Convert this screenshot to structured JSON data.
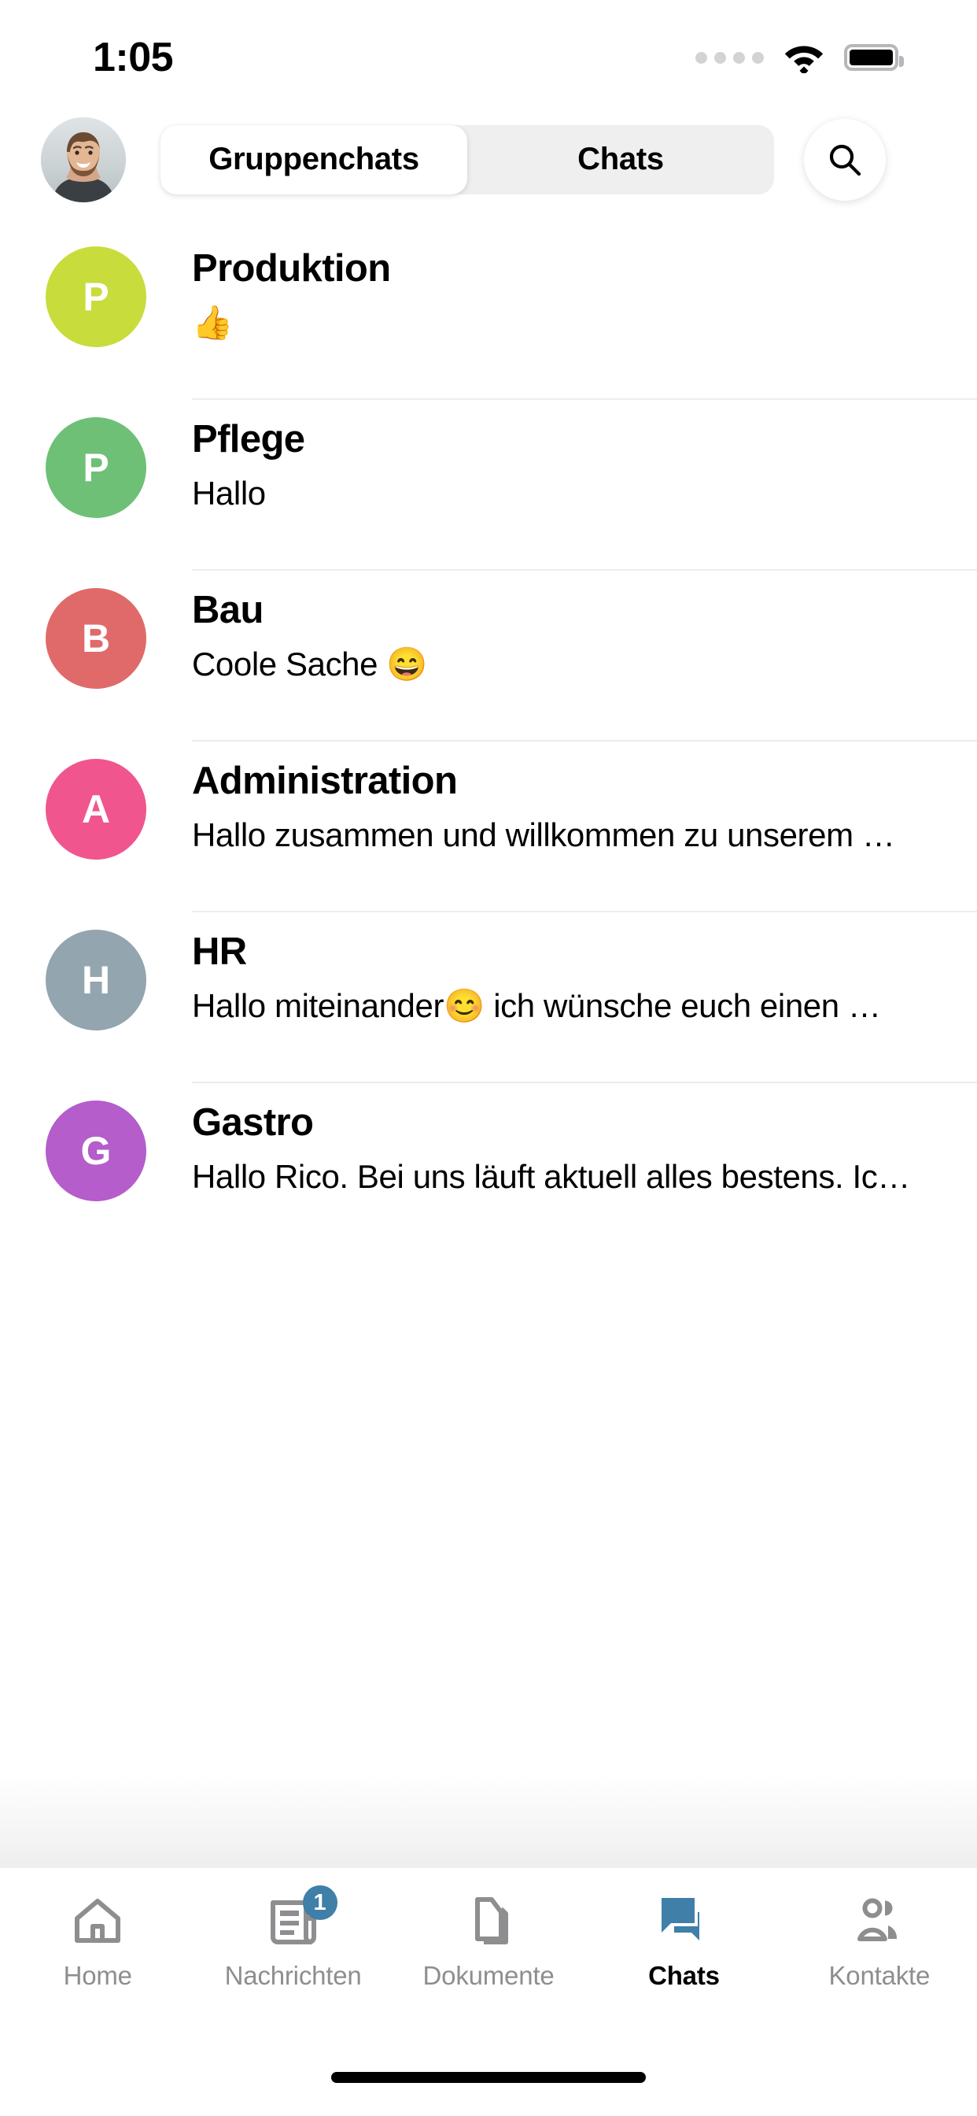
{
  "status_bar": {
    "time": "1:05",
    "dots_icon": "signal-dots-icon",
    "wifi_icon": "wifi-icon",
    "battery_icon": "battery-full-icon"
  },
  "header": {
    "avatar_name": "user-avatar-photo",
    "search_icon": "search-icon",
    "segments": [
      {
        "label": "Gruppenchats",
        "active": true
      },
      {
        "label": "Chats",
        "active": false
      }
    ]
  },
  "chats": [
    {
      "initial": "P",
      "title": "Produktion",
      "preview": "👍",
      "color": "#c8dc3c"
    },
    {
      "initial": "P",
      "title": "Pflege",
      "preview": "Hallo",
      "color": "#6ec077"
    },
    {
      "initial": "B",
      "title": "Bau",
      "preview": "Coole Sache 😄",
      "color": "#e06a6a"
    },
    {
      "initial": "A",
      "title": "Administration",
      "preview": "Hallo zusammen und willkommen zu unserem …",
      "color": "#f0558e"
    },
    {
      "initial": "H",
      "title": "HR",
      "preview": "Hallo miteinander😊  ich wünsche euch einen …",
      "color": "#93a5ae"
    },
    {
      "initial": "G",
      "title": "Gastro",
      "preview": "Hallo Rico. Bei uns läuft aktuell alles bestens. Ic…",
      "color": "#b45dcb"
    }
  ],
  "tab_bar": {
    "accent_color": "#3f7fa8",
    "inactive_color": "#8e8e90",
    "items": [
      {
        "label": "Home",
        "icon": "home-icon",
        "active": false,
        "badge": null
      },
      {
        "label": "Nachrichten",
        "icon": "newspaper-icon",
        "active": false,
        "badge": "1"
      },
      {
        "label": "Dokumente",
        "icon": "documents-icon",
        "active": false,
        "badge": null
      },
      {
        "label": "Chats",
        "icon": "chat-bubbles-icon",
        "active": true,
        "badge": null
      },
      {
        "label": "Kontakte",
        "icon": "contacts-icon",
        "active": false,
        "badge": null
      }
    ]
  }
}
